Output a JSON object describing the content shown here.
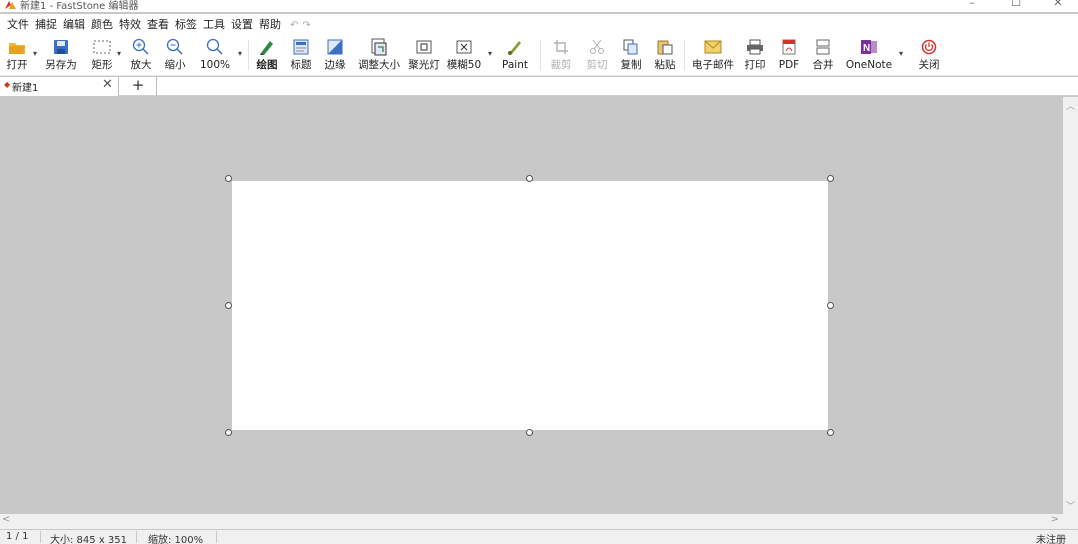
{
  "window": {
    "title": "新建1 - FastStone 编辑器",
    "controls": {
      "minimize": "–",
      "maximize": "☐",
      "close": "✕"
    }
  },
  "menu": {
    "items": [
      "文件",
      "捕捉",
      "编辑",
      "颜色",
      "特效",
      "查看",
      "标签",
      "工具",
      "设置",
      "帮助"
    ],
    "undo": "↶",
    "redo": "↷"
  },
  "toolbar": {
    "open": "打开",
    "save_as": "另存为",
    "rectangle": "矩形",
    "zoom_in": "放大",
    "zoom_out": "缩小",
    "zoom_100": "100%",
    "draw": "绘图",
    "caption": "标题",
    "edge": "边缘",
    "resize": "调整大小",
    "spotlight": "聚光灯",
    "blur": "模糊50",
    "paint": "Paint",
    "crop": "裁剪",
    "cut": "剪切",
    "copy": "复制",
    "paste": "粘贴",
    "email": "电子邮件",
    "print": "打印",
    "pdf": "PDF",
    "merge": "合并",
    "onenote": "OneNote",
    "close": "关闭"
  },
  "tabs": {
    "active": {
      "label": "新建1",
      "close": "✕"
    },
    "add": "+"
  },
  "canvas": {
    "scroll_up": "︿",
    "scroll_down": "﹀",
    "scroll_left": "<",
    "scroll_right": ">"
  },
  "status": {
    "page": "1 / 1",
    "size": "大小: 845 x 351",
    "zoom": "缩放: 100%",
    "registration": "未注册"
  },
  "colors": {
    "canvas_bg": "#c8c8c8",
    "accent_orange": "#e8a020",
    "accent_blue": "#3a6fc4",
    "onenote_purple": "#7b2f9e",
    "close_red": "#d9302c"
  }
}
